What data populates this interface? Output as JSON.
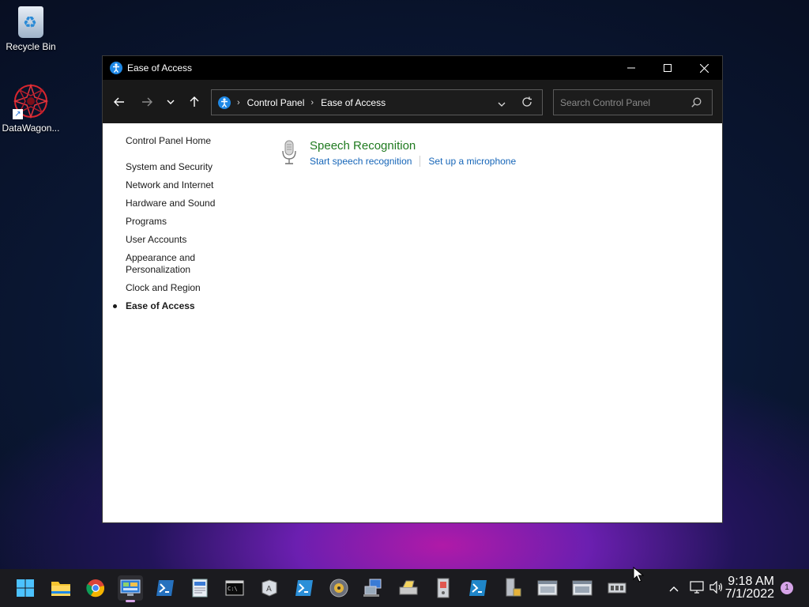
{
  "desktop": {
    "icons": [
      {
        "label": "Recycle Bin",
        "icon": "recycle-bin-icon"
      },
      {
        "label": "DataWagon...",
        "icon": "datawagon-icon"
      }
    ]
  },
  "window": {
    "title": "Ease of Access",
    "controls": {
      "minimize": "minimize-icon",
      "maximize": "maximize-icon",
      "close": "close-icon"
    },
    "nav": {
      "back": "back-arrow-icon",
      "forward": "forward-arrow-icon",
      "recent": "chevron-down-icon",
      "up": "up-arrow-icon"
    },
    "address": {
      "crumbs": [
        "Control Panel",
        "Ease of Access"
      ]
    },
    "search": {
      "placeholder": "Search Control Panel"
    },
    "sidebar": {
      "home": "Control Panel Home",
      "items": [
        "System and Security",
        "Network and Internet",
        "Hardware and Sound",
        "Programs",
        "User Accounts",
        "Appearance and Personalization",
        "Clock and Region",
        "Ease of Access"
      ],
      "active_index": 7
    },
    "main": {
      "section_title": "Speech Recognition",
      "links": [
        "Start speech recognition",
        "Set up a microphone"
      ]
    }
  },
  "taskbar": {
    "apps": [
      "start",
      "file-explorer",
      "chrome",
      "control-panel",
      "powershell",
      "notepad-doc",
      "terminal",
      "app-6",
      "powershell-2",
      "disc-app",
      "network-app",
      "scanner-app",
      "doc-app",
      "app-12",
      "app-13",
      "app-14",
      "app-15",
      "app-16"
    ],
    "active_index": 3,
    "clock": {
      "time": "9:18 AM",
      "date": "7/1/2022"
    },
    "notification_count": "1"
  },
  "colors": {
    "link": "#1565b8",
    "section_title": "#1f7a1f",
    "titlebar": "#000000",
    "navbar": "#191919",
    "taskbar": "#1b1b1f"
  }
}
